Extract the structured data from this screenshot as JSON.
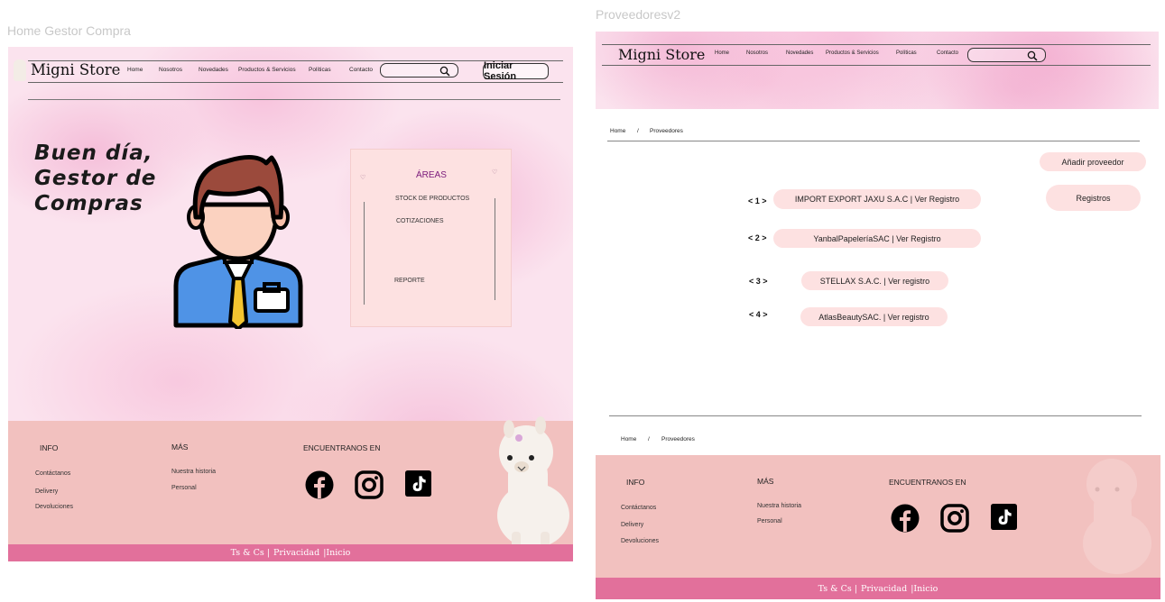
{
  "frames": {
    "left_label": "Home Gestor Compra",
    "right_label": "Proveedoresv2"
  },
  "nav": {
    "brand": "Migni Store",
    "links": [
      "Home",
      "Nosotros",
      "Novedades",
      "Productos & Servicios",
      "Políticas",
      "Contacto"
    ],
    "login": "Iniciar Sesión",
    "search_icon": "search-icon"
  },
  "home": {
    "greeting_line1": "Buen día,",
    "greeting_line2": "Gestor de",
    "greeting_line3": "Compras",
    "areas_title": "ÁREAS",
    "areas_items": [
      "STOCK DE PRODUCTOS",
      "COTIZACIONES",
      "REPORTE"
    ]
  },
  "footer": {
    "info_title": "INFO",
    "info_links": [
      "Contáctanos",
      "Delivery",
      "Devoluciones"
    ],
    "mas_title": "MÁS",
    "mas_links": [
      "Nuestra historia",
      "Personal"
    ],
    "social_title": "ENCUENTRANOS EN",
    "social_icons": [
      "facebook-icon",
      "instagram-icon",
      "tiktok-icon"
    ],
    "bottom_links": [
      "Ts & Cs |",
      "Privacidad",
      "|Inicio"
    ]
  },
  "proveedores": {
    "breadcrumb": [
      "Home",
      "/",
      "Proveedores"
    ],
    "add_button": "Añadir proveedor",
    "records_button": "Registros",
    "rows": [
      {
        "index": "< 1 >",
        "label": "IMPORT EXPORT JAXU S.A.C | Ver Registro"
      },
      {
        "index": "< 2 >",
        "label": "YanbalPapeleríaSAC | Ver Registro"
      },
      {
        "index": "< 3 >",
        "label": "STELLAX S.A.C. | Ver registro"
      },
      {
        "index": "< 4 >",
        "label": "AtlasBeautySAC. | Ver registro"
      }
    ]
  },
  "colors": {
    "pink_bg": "#fbe3ee",
    "footer": "#f2c1bf",
    "bottom_bar": "#e2709b",
    "pill": "#fde1e1",
    "areas_title": "#7a1a7a"
  }
}
